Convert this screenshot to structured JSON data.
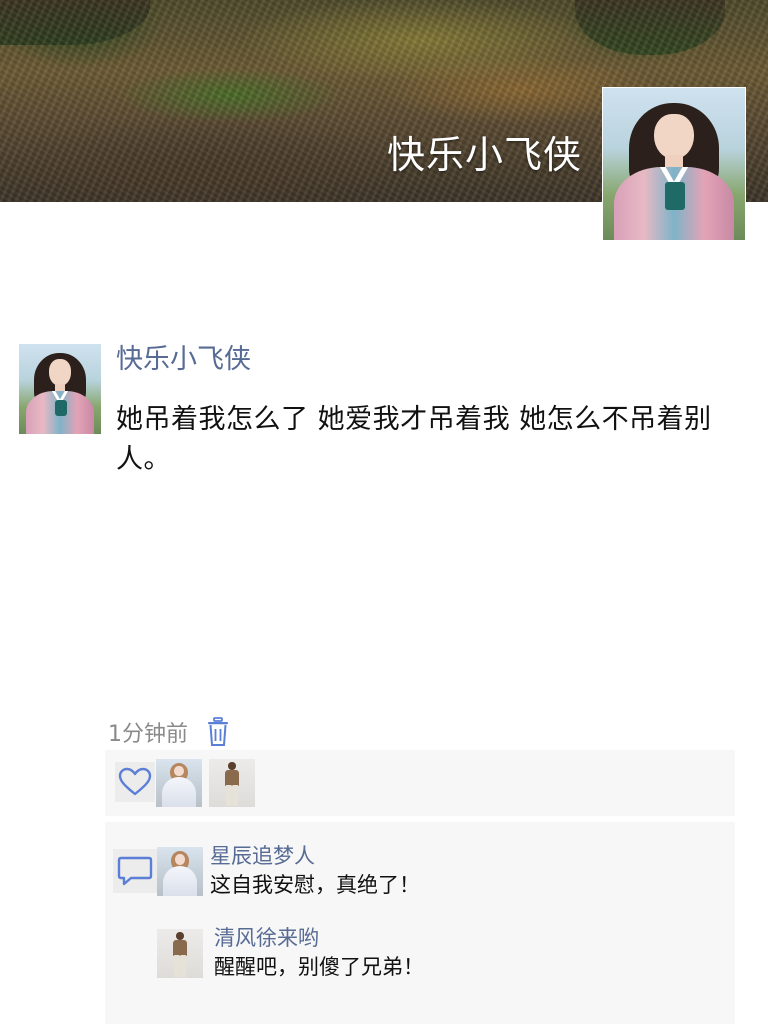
{
  "cover": {
    "title": "快乐小飞侠"
  },
  "post": {
    "author": "快乐小飞侠",
    "text": "她吊着我怎么了 她爱我才吊着我 她怎么不吊着别人。",
    "time": "1分钟前"
  },
  "likes": {
    "count": 2
  },
  "comments": [
    {
      "author": "星辰追梦人",
      "text": "这自我安慰，真绝了！"
    },
    {
      "author": "清风徐来哟",
      "text": "醒醒吧，别傻了兄弟！"
    }
  ],
  "icons": {
    "delete": "trash-icon",
    "like": "heart-outline-icon",
    "comment": "speech-bubble-icon"
  },
  "colors": {
    "link_name": "#576b95",
    "icon_blue": "#5b7fd6"
  }
}
